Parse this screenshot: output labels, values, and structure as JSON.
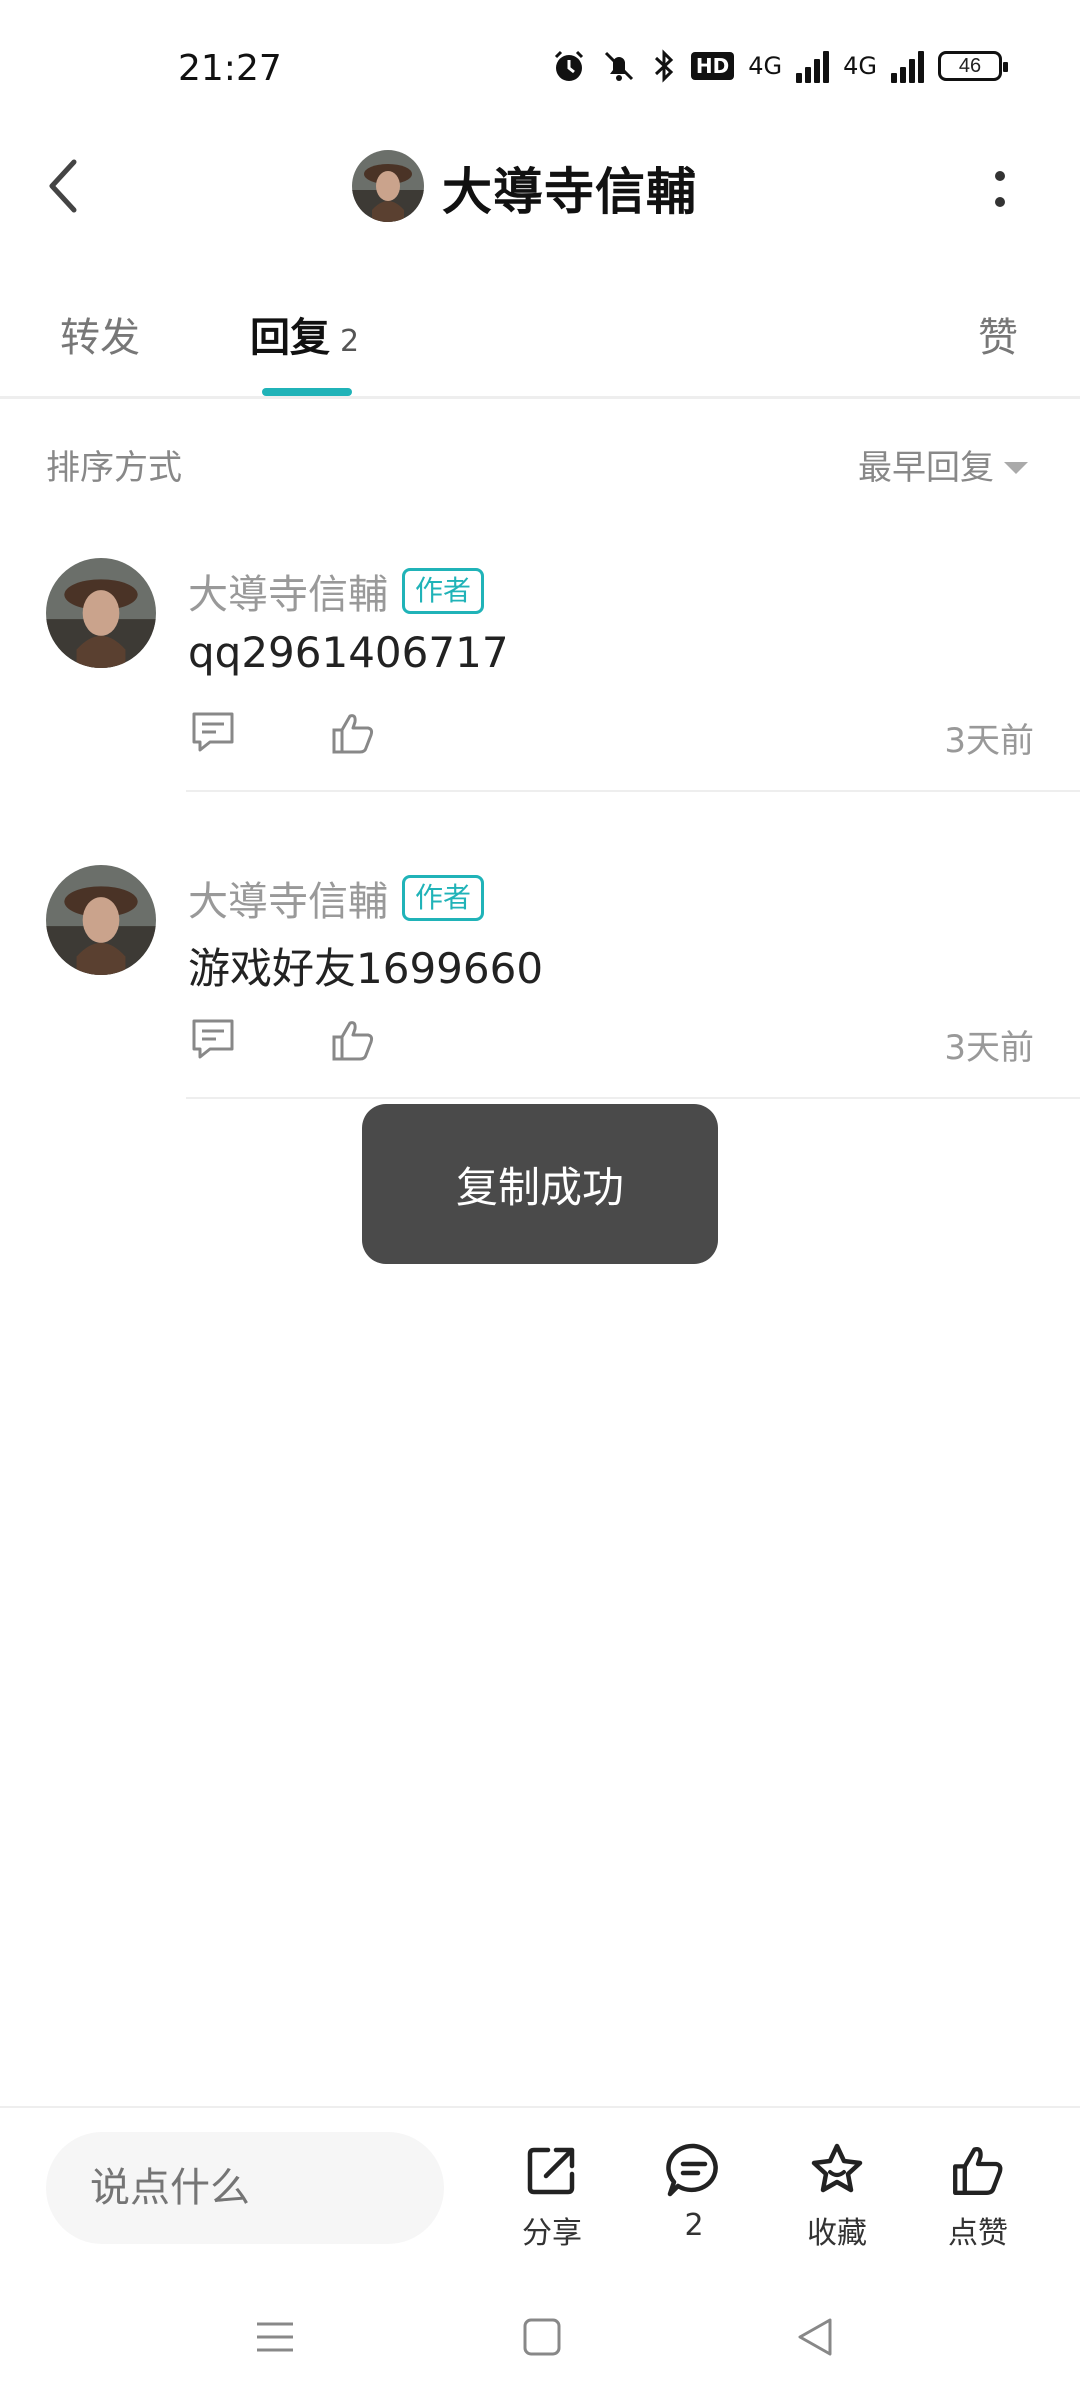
{
  "status_bar": {
    "time": "21:27",
    "network_1": "4G",
    "network_2": "4G",
    "hd_label": "HD",
    "battery": "46",
    "icons": [
      "alarm-icon",
      "mute-icon",
      "bluetooth-icon",
      "hd-icon",
      "signal-icon",
      "signal-icon",
      "battery-icon"
    ]
  },
  "header": {
    "title": "大導寺信輔",
    "back_icon": "chevron-left-icon",
    "more_icon": "more-vertical-icon"
  },
  "tabs": [
    {
      "label": "转发"
    },
    {
      "label": "回复",
      "count": "2"
    },
    {
      "label": "赞"
    }
  ],
  "sort": {
    "label": "排序方式",
    "selected": "最早回复"
  },
  "replies": [
    {
      "name": "大導寺信輔",
      "badge": "作者",
      "content": "qq2961406717",
      "time": "3天前"
    },
    {
      "name": "大導寺信輔",
      "badge": "作者",
      "content": "游戏好友1699660",
      "time": "3天前"
    }
  ],
  "toast": {
    "message": "复制成功"
  },
  "bottom_bar": {
    "input_placeholder": "说点什么",
    "share_label": "分享",
    "comment_count": "2",
    "favorite_label": "收藏",
    "like_label": "点赞"
  },
  "colors": {
    "accent": "#20b3b8",
    "toast_bg": "#4a4a4a"
  }
}
